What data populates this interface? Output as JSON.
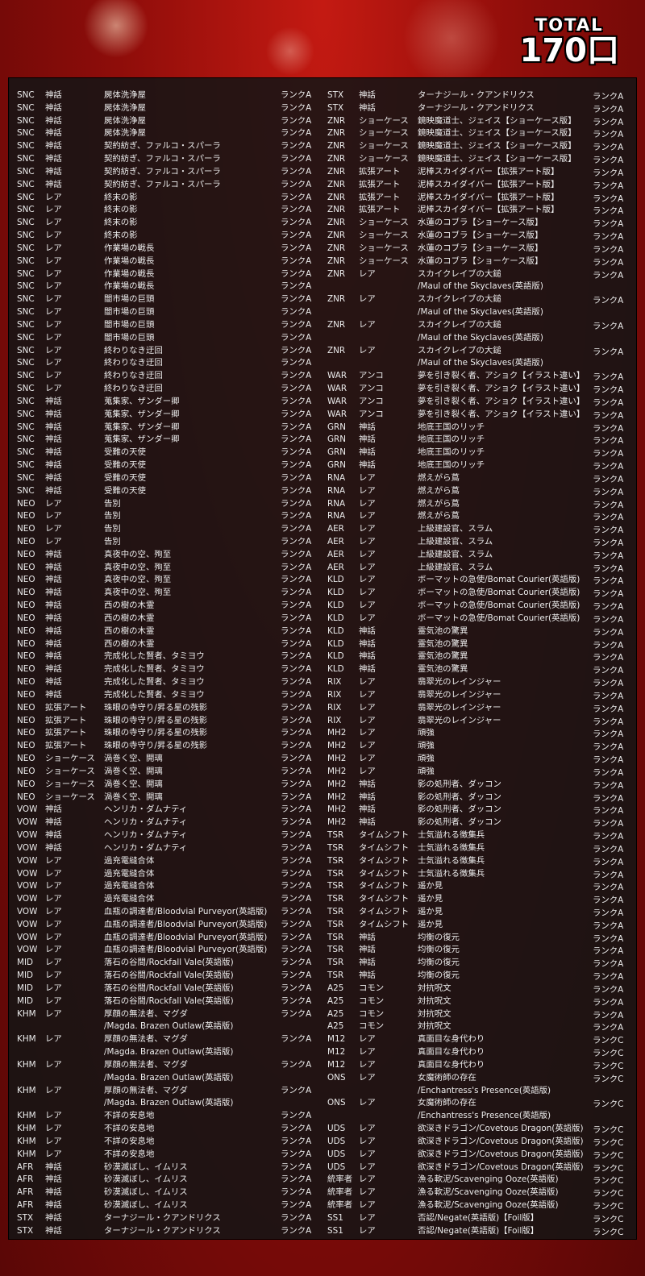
{
  "header": {
    "total_label": "TOTAL",
    "total_value": "170口"
  },
  "left_rows": [
    {
      "set": "SNC",
      "rarity": "神話",
      "name": "屍体洗浄屋",
      "rank": "ランクA"
    },
    {
      "set": "SNC",
      "rarity": "神話",
      "name": "屍体洗浄屋",
      "rank": "ランクA"
    },
    {
      "set": "SNC",
      "rarity": "神話",
      "name": "屍体洗浄屋",
      "rank": "ランクA"
    },
    {
      "set": "SNC",
      "rarity": "神話",
      "name": "屍体洗浄屋",
      "rank": "ランクA"
    },
    {
      "set": "SNC",
      "rarity": "神話",
      "name": "契約紡ぎ、ファルコ・スパーラ",
      "rank": "ランクA"
    },
    {
      "set": "SNC",
      "rarity": "神話",
      "name": "契約紡ぎ、ファルコ・スパーラ",
      "rank": "ランクA"
    },
    {
      "set": "SNC",
      "rarity": "神話",
      "name": "契約紡ぎ、ファルコ・スパーラ",
      "rank": "ランクA"
    },
    {
      "set": "SNC",
      "rarity": "神話",
      "name": "契約紡ぎ、ファルコ・スパーラ",
      "rank": "ランクA"
    },
    {
      "set": "SNC",
      "rarity": "レア",
      "name": "終末の影",
      "rank": "ランクA"
    },
    {
      "set": "SNC",
      "rarity": "レア",
      "name": "終末の影",
      "rank": "ランクA"
    },
    {
      "set": "SNC",
      "rarity": "レア",
      "name": "終末の影",
      "rank": "ランクA"
    },
    {
      "set": "SNC",
      "rarity": "レア",
      "name": "終末の影",
      "rank": "ランクA"
    },
    {
      "set": "SNC",
      "rarity": "レア",
      "name": "作業場の戦長",
      "rank": "ランクA"
    },
    {
      "set": "SNC",
      "rarity": "レア",
      "name": "作業場の戦長",
      "rank": "ランクA"
    },
    {
      "set": "SNC",
      "rarity": "レア",
      "name": "作業場の戦長",
      "rank": "ランクA"
    },
    {
      "set": "SNC",
      "rarity": "レア",
      "name": "作業場の戦長",
      "rank": "ランクA"
    },
    {
      "set": "SNC",
      "rarity": "レア",
      "name": "闇市場の巨頭",
      "rank": "ランクA"
    },
    {
      "set": "SNC",
      "rarity": "レア",
      "name": "闇市場の巨頭",
      "rank": "ランクA"
    },
    {
      "set": "SNC",
      "rarity": "レア",
      "name": "闇市場の巨頭",
      "rank": "ランクA"
    },
    {
      "set": "SNC",
      "rarity": "レア",
      "name": "闇市場の巨頭",
      "rank": "ランクA"
    },
    {
      "set": "SNC",
      "rarity": "レア",
      "name": "終わりなき迂回",
      "rank": "ランクA"
    },
    {
      "set": "SNC",
      "rarity": "レア",
      "name": "終わりなき迂回",
      "rank": "ランクA"
    },
    {
      "set": "SNC",
      "rarity": "レア",
      "name": "終わりなき迂回",
      "rank": "ランクA"
    },
    {
      "set": "SNC",
      "rarity": "レア",
      "name": "終わりなき迂回",
      "rank": "ランクA"
    },
    {
      "set": "SNC",
      "rarity": "神話",
      "name": "蒐集家、ザンダー卿",
      "rank": "ランクA"
    },
    {
      "set": "SNC",
      "rarity": "神話",
      "name": "蒐集家、ザンダー卿",
      "rank": "ランクA"
    },
    {
      "set": "SNC",
      "rarity": "神話",
      "name": "蒐集家、ザンダー卿",
      "rank": "ランクA"
    },
    {
      "set": "SNC",
      "rarity": "神話",
      "name": "蒐集家、ザンダー卿",
      "rank": "ランクA"
    },
    {
      "set": "SNC",
      "rarity": "神話",
      "name": "受難の天使",
      "rank": "ランクA"
    },
    {
      "set": "SNC",
      "rarity": "神話",
      "name": "受難の天使",
      "rank": "ランクA"
    },
    {
      "set": "SNC",
      "rarity": "神話",
      "name": "受難の天使",
      "rank": "ランクA"
    },
    {
      "set": "SNC",
      "rarity": "神話",
      "name": "受難の天使",
      "rank": "ランクA"
    },
    {
      "set": "NEO",
      "rarity": "レア",
      "name": "告別",
      "rank": "ランクA"
    },
    {
      "set": "NEO",
      "rarity": "レア",
      "name": "告別",
      "rank": "ランクA"
    },
    {
      "set": "NEO",
      "rarity": "レア",
      "name": "告別",
      "rank": "ランクA"
    },
    {
      "set": "NEO",
      "rarity": "レア",
      "name": "告別",
      "rank": "ランクA"
    },
    {
      "set": "NEO",
      "rarity": "神話",
      "name": "真夜中の空、殉至",
      "rank": "ランクA"
    },
    {
      "set": "NEO",
      "rarity": "神話",
      "name": "真夜中の空、殉至",
      "rank": "ランクA"
    },
    {
      "set": "NEO",
      "rarity": "神話",
      "name": "真夜中の空、殉至",
      "rank": "ランクA"
    },
    {
      "set": "NEO",
      "rarity": "神話",
      "name": "真夜中の空、殉至",
      "rank": "ランクA"
    },
    {
      "set": "NEO",
      "rarity": "神話",
      "name": "西の樹の木霊",
      "rank": "ランクA"
    },
    {
      "set": "NEO",
      "rarity": "神話",
      "name": "西の樹の木霊",
      "rank": "ランクA"
    },
    {
      "set": "NEO",
      "rarity": "神話",
      "name": "西の樹の木霊",
      "rank": "ランクA"
    },
    {
      "set": "NEO",
      "rarity": "神話",
      "name": "西の樹の木霊",
      "rank": "ランクA"
    },
    {
      "set": "NEO",
      "rarity": "神話",
      "name": "完成化した賢者、タミヨウ",
      "rank": "ランクA"
    },
    {
      "set": "NEO",
      "rarity": "神話",
      "name": "完成化した賢者、タミヨウ",
      "rank": "ランクA"
    },
    {
      "set": "NEO",
      "rarity": "神話",
      "name": "完成化した賢者、タミヨウ",
      "rank": "ランクA"
    },
    {
      "set": "NEO",
      "rarity": "神話",
      "name": "完成化した賢者、タミヨウ",
      "rank": "ランクA"
    },
    {
      "set": "NEO",
      "rarity": "拡張アート",
      "name": "珠眼の寺守り/昇る星の残影",
      "rank": "ランクA"
    },
    {
      "set": "NEO",
      "rarity": "拡張アート",
      "name": "珠眼の寺守り/昇る星の残影",
      "rank": "ランクA"
    },
    {
      "set": "NEO",
      "rarity": "拡張アート",
      "name": "珠眼の寺守り/昇る星の残影",
      "rank": "ランクA"
    },
    {
      "set": "NEO",
      "rarity": "拡張アート",
      "name": "珠眼の寺守り/昇る星の残影",
      "rank": "ランクA"
    },
    {
      "set": "NEO",
      "rarity": "ショーケース",
      "name": "渦巻く空、開璃",
      "rank": "ランクA"
    },
    {
      "set": "NEO",
      "rarity": "ショーケース",
      "name": "渦巻く空、開璃",
      "rank": "ランクA"
    },
    {
      "set": "NEO",
      "rarity": "ショーケース",
      "name": "渦巻く空、開璃",
      "rank": "ランクA"
    },
    {
      "set": "NEO",
      "rarity": "ショーケース",
      "name": "渦巻く空、開璃",
      "rank": "ランクA"
    },
    {
      "set": "VOW",
      "rarity": "神話",
      "name": "ヘンリカ・ダムナティ",
      "rank": "ランクA"
    },
    {
      "set": "VOW",
      "rarity": "神話",
      "name": "ヘンリカ・ダムナティ",
      "rank": "ランクA"
    },
    {
      "set": "VOW",
      "rarity": "神話",
      "name": "ヘンリカ・ダムナティ",
      "rank": "ランクA"
    },
    {
      "set": "VOW",
      "rarity": "神話",
      "name": "ヘンリカ・ダムナティ",
      "rank": "ランクA"
    },
    {
      "set": "VOW",
      "rarity": "レア",
      "name": "過充電縫合体",
      "rank": "ランクA"
    },
    {
      "set": "VOW",
      "rarity": "レア",
      "name": "過充電縫合体",
      "rank": "ランクA"
    },
    {
      "set": "VOW",
      "rarity": "レア",
      "name": "過充電縫合体",
      "rank": "ランクA"
    },
    {
      "set": "VOW",
      "rarity": "レア",
      "name": "過充電縫合体",
      "rank": "ランクA"
    },
    {
      "set": "VOW",
      "rarity": "レア",
      "name": "血瓶の調達者/Bloodvial Purveyor(英語版)",
      "rank": "ランクA"
    },
    {
      "set": "VOW",
      "rarity": "レア",
      "name": "血瓶の調達者/Bloodvial Purveyor(英語版)",
      "rank": "ランクA"
    },
    {
      "set": "VOW",
      "rarity": "レア",
      "name": "血瓶の調達者/Bloodvial Purveyor(英語版)",
      "rank": "ランクA"
    },
    {
      "set": "VOW",
      "rarity": "レア",
      "name": "血瓶の調達者/Bloodvial Purveyor(英語版)",
      "rank": "ランクA"
    },
    {
      "set": "MID",
      "rarity": "レア",
      "name": "落石の谷間/Rockfall Vale(英語版)",
      "rank": "ランクA"
    },
    {
      "set": "MID",
      "rarity": "レア",
      "name": "落石の谷間/Rockfall Vale(英語版)",
      "rank": "ランクA"
    },
    {
      "set": "MID",
      "rarity": "レア",
      "name": "落石の谷間/Rockfall Vale(英語版)",
      "rank": "ランクA"
    },
    {
      "set": "MID",
      "rarity": "レア",
      "name": "落石の谷間/Rockfall Vale(英語版)",
      "rank": "ランクA"
    },
    {
      "set": "KHM",
      "rarity": "レア",
      "name": "厚顔の無法者、マグダ",
      "rank": "ランクA"
    },
    {
      "set": "",
      "rarity": "",
      "name": "/Magda. Brazen Outlaw(英語版)",
      "rank": ""
    },
    {
      "set": "KHM",
      "rarity": "レア",
      "name": "厚顔の無法者、マグダ",
      "rank": "ランクA"
    },
    {
      "set": "",
      "rarity": "",
      "name": "/Magda. Brazen Outlaw(英語版)",
      "rank": ""
    },
    {
      "set": "KHM",
      "rarity": "レア",
      "name": "厚顔の無法者、マグダ",
      "rank": "ランクA"
    },
    {
      "set": "",
      "rarity": "",
      "name": "/Magda. Brazen Outlaw(英語版)",
      "rank": ""
    },
    {
      "set": "KHM",
      "rarity": "レア",
      "name": "厚顔の無法者、マグダ",
      "rank": "ランクA"
    },
    {
      "set": "",
      "rarity": "",
      "name": "/Magda. Brazen Outlaw(英語版)",
      "rank": ""
    },
    {
      "set": "KHM",
      "rarity": "レア",
      "name": "不詳の安息地",
      "rank": "ランクA"
    },
    {
      "set": "KHM",
      "rarity": "レア",
      "name": "不詳の安息地",
      "rank": "ランクA"
    },
    {
      "set": "KHM",
      "rarity": "レア",
      "name": "不詳の安息地",
      "rank": "ランクA"
    },
    {
      "set": "KHM",
      "rarity": "レア",
      "name": "不詳の安息地",
      "rank": "ランクA"
    },
    {
      "set": "AFR",
      "rarity": "神話",
      "name": "砂漠滅ぼし、イムリス",
      "rank": "ランクA"
    },
    {
      "set": "AFR",
      "rarity": "神話",
      "name": "砂漠滅ぼし、イムリス",
      "rank": "ランクA"
    },
    {
      "set": "AFR",
      "rarity": "神話",
      "name": "砂漠滅ぼし、イムリス",
      "rank": "ランクA"
    },
    {
      "set": "AFR",
      "rarity": "神話",
      "name": "砂漠滅ぼし、イムリス",
      "rank": "ランクA"
    },
    {
      "set": "STX",
      "rarity": "神話",
      "name": "ターナジール・クアンドリクス",
      "rank": "ランクA"
    },
    {
      "set": "STX",
      "rarity": "神話",
      "name": "ターナジール・クアンドリクス",
      "rank": "ランクA"
    }
  ],
  "right_rows": [
    {
      "set": "STX",
      "rarity": "神話",
      "name": "ターナジール・クアンドリクス",
      "rank": "ランクA"
    },
    {
      "set": "STX",
      "rarity": "神話",
      "name": "ターナジール・クアンドリクス",
      "rank": "ランクA"
    },
    {
      "set": "ZNR",
      "rarity": "ショーケース",
      "name": "鏡映魔道士、ジェイス【ショーケース版】",
      "rank": "ランクA"
    },
    {
      "set": "ZNR",
      "rarity": "ショーケース",
      "name": "鏡映魔道士、ジェイス【ショーケース版】",
      "rank": "ランクA"
    },
    {
      "set": "ZNR",
      "rarity": "ショーケース",
      "name": "鏡映魔道士、ジェイス【ショーケース版】",
      "rank": "ランクA"
    },
    {
      "set": "ZNR",
      "rarity": "ショーケース",
      "name": "鏡映魔道士、ジェイス【ショーケース版】",
      "rank": "ランクA"
    },
    {
      "set": "ZNR",
      "rarity": "拡張アート",
      "name": "泥棒スカイダイバー【拡張アート版】",
      "rank": "ランクA"
    },
    {
      "set": "ZNR",
      "rarity": "拡張アート",
      "name": "泥棒スカイダイバー【拡張アート版】",
      "rank": "ランクA"
    },
    {
      "set": "ZNR",
      "rarity": "拡張アート",
      "name": "泥棒スカイダイバー【拡張アート版】",
      "rank": "ランクA"
    },
    {
      "set": "ZNR",
      "rarity": "拡張アート",
      "name": "泥棒スカイダイバー【拡張アート版】",
      "rank": "ランクA"
    },
    {
      "set": "ZNR",
      "rarity": "ショーケース",
      "name": "水蓮のコブラ【ショーケース版】",
      "rank": "ランクA"
    },
    {
      "set": "ZNR",
      "rarity": "ショーケース",
      "name": "水蓮のコブラ【ショーケース版】",
      "rank": "ランクA"
    },
    {
      "set": "ZNR",
      "rarity": "ショーケース",
      "name": "水蓮のコブラ【ショーケース版】",
      "rank": "ランクA"
    },
    {
      "set": "ZNR",
      "rarity": "ショーケース",
      "name": "水蓮のコブラ【ショーケース版】",
      "rank": "ランクA"
    },
    {
      "set": "ZNR",
      "rarity": "レア",
      "name": "スカイクレイブの大鎚",
      "rank": "ランクA"
    },
    {
      "set": "",
      "rarity": "",
      "name": "/Maul of the Skyclaves(英語版)",
      "rank": ""
    },
    {
      "set": "ZNR",
      "rarity": "レア",
      "name": "スカイクレイブの大鎚",
      "rank": "ランクA"
    },
    {
      "set": "",
      "rarity": "",
      "name": "/Maul of the Skyclaves(英語版)",
      "rank": ""
    },
    {
      "set": "ZNR",
      "rarity": "レア",
      "name": "スカイクレイブの大鎚",
      "rank": "ランクA"
    },
    {
      "set": "",
      "rarity": "",
      "name": "/Maul of the Skyclaves(英語版)",
      "rank": ""
    },
    {
      "set": "ZNR",
      "rarity": "レア",
      "name": "スカイクレイブの大鎚",
      "rank": "ランクA"
    },
    {
      "set": "",
      "rarity": "",
      "name": "/Maul of the Skyclaves(英語版)",
      "rank": ""
    },
    {
      "set": "WAR",
      "rarity": "アンコ",
      "name": "夢を引き裂く者、アショク【イラスト違い】",
      "rank": "ランクA"
    },
    {
      "set": "WAR",
      "rarity": "アンコ",
      "name": "夢を引き裂く者、アショク【イラスト違い】",
      "rank": "ランクA"
    },
    {
      "set": "WAR",
      "rarity": "アンコ",
      "name": "夢を引き裂く者、アショク【イラスト違い】",
      "rank": "ランクA"
    },
    {
      "set": "WAR",
      "rarity": "アンコ",
      "name": "夢を引き裂く者、アショク【イラスト違い】",
      "rank": "ランクA"
    },
    {
      "set": "GRN",
      "rarity": "神話",
      "name": "地底王国のリッチ",
      "rank": "ランクA"
    },
    {
      "set": "GRN",
      "rarity": "神話",
      "name": "地底王国のリッチ",
      "rank": "ランクA"
    },
    {
      "set": "GRN",
      "rarity": "神話",
      "name": "地底王国のリッチ",
      "rank": "ランクA"
    },
    {
      "set": "GRN",
      "rarity": "神話",
      "name": "地底王国のリッチ",
      "rank": "ランクA"
    },
    {
      "set": "RNA",
      "rarity": "レア",
      "name": "燃えがら蔦",
      "rank": "ランクA"
    },
    {
      "set": "RNA",
      "rarity": "レア",
      "name": "燃えがら蔦",
      "rank": "ランクA"
    },
    {
      "set": "RNA",
      "rarity": "レア",
      "name": "燃えがら蔦",
      "rank": "ランクA"
    },
    {
      "set": "RNA",
      "rarity": "レア",
      "name": "燃えがら蔦",
      "rank": "ランクA"
    },
    {
      "set": "AER",
      "rarity": "レア",
      "name": "上級建設官、スラム",
      "rank": "ランクA"
    },
    {
      "set": "AER",
      "rarity": "レア",
      "name": "上級建設官、スラム",
      "rank": "ランクA"
    },
    {
      "set": "AER",
      "rarity": "レア",
      "name": "上級建設官、スラム",
      "rank": "ランクA"
    },
    {
      "set": "AER",
      "rarity": "レア",
      "name": "上級建設官、スラム",
      "rank": "ランクA"
    },
    {
      "set": "KLD",
      "rarity": "レア",
      "name": "ボーマットの急使/Bomat Courier(英語版)",
      "rank": "ランクA"
    },
    {
      "set": "KLD",
      "rarity": "レア",
      "name": "ボーマットの急使/Bomat Courier(英語版)",
      "rank": "ランクA"
    },
    {
      "set": "KLD",
      "rarity": "レア",
      "name": "ボーマットの急使/Bomat Courier(英語版)",
      "rank": "ランクA"
    },
    {
      "set": "KLD",
      "rarity": "レア",
      "name": "ボーマットの急使/Bomat Courier(英語版)",
      "rank": "ランクA"
    },
    {
      "set": "KLD",
      "rarity": "神話",
      "name": "霊気池の驚異",
      "rank": "ランクA"
    },
    {
      "set": "KLD",
      "rarity": "神話",
      "name": "霊気池の驚異",
      "rank": "ランクA"
    },
    {
      "set": "KLD",
      "rarity": "神話",
      "name": "霊気池の驚異",
      "rank": "ランクA"
    },
    {
      "set": "KLD",
      "rarity": "神話",
      "name": "霊気池の驚異",
      "rank": "ランクA"
    },
    {
      "set": "RIX",
      "rarity": "レア",
      "name": "翡翠光のレインジャー",
      "rank": "ランクA"
    },
    {
      "set": "RIX",
      "rarity": "レア",
      "name": "翡翠光のレインジャー",
      "rank": "ランクA"
    },
    {
      "set": "RIX",
      "rarity": "レア",
      "name": "翡翠光のレインジャー",
      "rank": "ランクA"
    },
    {
      "set": "RIX",
      "rarity": "レア",
      "name": "翡翠光のレインジャー",
      "rank": "ランクA"
    },
    {
      "set": "MH2",
      "rarity": "レア",
      "name": "頑強",
      "rank": "ランクA"
    },
    {
      "set": "MH2",
      "rarity": "レア",
      "name": "頑強",
      "rank": "ランクA"
    },
    {
      "set": "MH2",
      "rarity": "レア",
      "name": "頑強",
      "rank": "ランクA"
    },
    {
      "set": "MH2",
      "rarity": "レア",
      "name": "頑強",
      "rank": "ランクA"
    },
    {
      "set": "MH2",
      "rarity": "神話",
      "name": "影の処刑者、ダッコン",
      "rank": "ランクA"
    },
    {
      "set": "MH2",
      "rarity": "神話",
      "name": "影の処刑者、ダッコン",
      "rank": "ランクA"
    },
    {
      "set": "MH2",
      "rarity": "神話",
      "name": "影の処刑者、ダッコン",
      "rank": "ランクA"
    },
    {
      "set": "MH2",
      "rarity": "神話",
      "name": "影の処刑者、ダッコン",
      "rank": "ランクA"
    },
    {
      "set": "TSR",
      "rarity": "タイムシフト",
      "name": "士気溢れる徴集兵",
      "rank": "ランクA"
    },
    {
      "set": "TSR",
      "rarity": "タイムシフト",
      "name": "士気溢れる徴集兵",
      "rank": "ランクA"
    },
    {
      "set": "TSR",
      "rarity": "タイムシフト",
      "name": "士気溢れる徴集兵",
      "rank": "ランクA"
    },
    {
      "set": "TSR",
      "rarity": "タイムシフト",
      "name": "士気溢れる徴集兵",
      "rank": "ランクA"
    },
    {
      "set": "TSR",
      "rarity": "タイムシフト",
      "name": "遥か見",
      "rank": "ランクA"
    },
    {
      "set": "TSR",
      "rarity": "タイムシフト",
      "name": "遥か見",
      "rank": "ランクA"
    },
    {
      "set": "TSR",
      "rarity": "タイムシフト",
      "name": "遥か見",
      "rank": "ランクA"
    },
    {
      "set": "TSR",
      "rarity": "タイムシフト",
      "name": "遥か見",
      "rank": "ランクA"
    },
    {
      "set": "TSR",
      "rarity": "神話",
      "name": "均衡の復元",
      "rank": "ランクA"
    },
    {
      "set": "TSR",
      "rarity": "神話",
      "name": "均衡の復元",
      "rank": "ランクA"
    },
    {
      "set": "TSR",
      "rarity": "神話",
      "name": "均衡の復元",
      "rank": "ランクA"
    },
    {
      "set": "TSR",
      "rarity": "神話",
      "name": "均衡の復元",
      "rank": "ランクA"
    },
    {
      "set": "A25",
      "rarity": "コモン",
      "name": "対抗呪文",
      "rank": "ランクA"
    },
    {
      "set": "A25",
      "rarity": "コモン",
      "name": "対抗呪文",
      "rank": "ランクA"
    },
    {
      "set": "A25",
      "rarity": "コモン",
      "name": "対抗呪文",
      "rank": "ランクA"
    },
    {
      "set": "A25",
      "rarity": "コモン",
      "name": "対抗呪文",
      "rank": "ランクA"
    },
    {
      "set": "M12",
      "rarity": "レア",
      "name": "真面目な身代わり",
      "rank": "ランクC"
    },
    {
      "set": "M12",
      "rarity": "レア",
      "name": "真面目な身代わり",
      "rank": "ランクC"
    },
    {
      "set": "M12",
      "rarity": "レア",
      "name": "真面目な身代わり",
      "rank": "ランクC"
    },
    {
      "set": "ONS",
      "rarity": "レア",
      "name": "女魔術師の存在",
      "rank": "ランクC"
    },
    {
      "set": "",
      "rarity": "",
      "name": "/Enchantress's Presence(英語版)",
      "rank": ""
    },
    {
      "set": "ONS",
      "rarity": "レア",
      "name": "女魔術師の存在",
      "rank": "ランクC"
    },
    {
      "set": "",
      "rarity": "",
      "name": "/Enchantress's Presence(英語版)",
      "rank": ""
    },
    {
      "set": "UDS",
      "rarity": "レア",
      "name": "欲深きドラゴン/Covetous Dragon(英語版)",
      "rank": "ランクC"
    },
    {
      "set": "UDS",
      "rarity": "レア",
      "name": "欲深きドラゴン/Covetous Dragon(英語版)",
      "rank": "ランクC"
    },
    {
      "set": "UDS",
      "rarity": "レア",
      "name": "欲深きドラゴン/Covetous Dragon(英語版)",
      "rank": "ランクC"
    },
    {
      "set": "UDS",
      "rarity": "レア",
      "name": "欲深きドラゴン/Covetous Dragon(英語版)",
      "rank": "ランクC"
    },
    {
      "set": "統率者",
      "rarity": "レア",
      "name": "漁る軟泥/Scavenging Ooze(英語版)",
      "rank": "ランクC"
    },
    {
      "set": "統率者",
      "rarity": "レア",
      "name": "漁る軟泥/Scavenging Ooze(英語版)",
      "rank": "ランクC"
    },
    {
      "set": "統率者",
      "rarity": "レア",
      "name": "漁る軟泥/Scavenging Ooze(英語版)",
      "rank": "ランクC"
    },
    {
      "set": "SS1",
      "rarity": "レア",
      "name": "否認/Negate(英語版)【Foil版】",
      "rank": "ランクC"
    },
    {
      "set": "SS1",
      "rarity": "レア",
      "name": "否認/Negate(英語版)【Foil版】",
      "rank": "ランクC"
    }
  ]
}
